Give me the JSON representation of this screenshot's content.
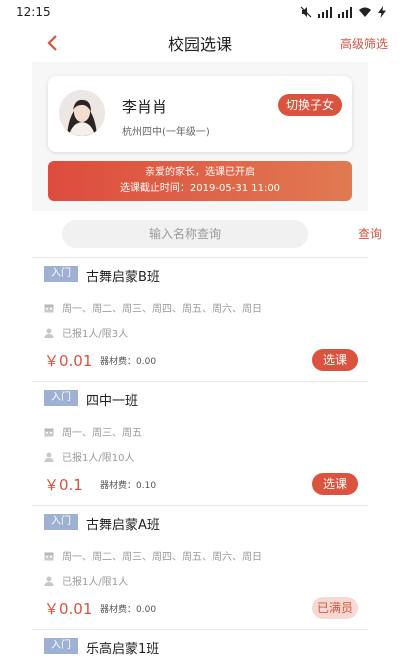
{
  "status_bar": {
    "time": "12:15"
  },
  "nav": {
    "back_icon": "chevron-left-icon",
    "title": "校园选课",
    "filter_label": "高级筛选"
  },
  "profile": {
    "name": "李肖肖",
    "school": "杭州四中(一年级一)",
    "switch_label": "切换子女"
  },
  "notice": {
    "line1": "亲爱的家长，选课已开启",
    "line2": "选课截止时间：2019-05-31 11:00"
  },
  "search": {
    "placeholder": "输入名称查询",
    "value": "",
    "button_label": "查询"
  },
  "courses": [
    {
      "badge": "入门",
      "name": "古舞启蒙B班",
      "days": "周一、周二、周三、周四、周五、周六、周日",
      "enroll": "已报1人/限3人",
      "price": "￥0.01",
      "fee": "器材费：0.00",
      "action": "选课",
      "full": false
    },
    {
      "badge": "入门",
      "name": "四中一班",
      "days": "周一、周三、周五",
      "enroll": "已报1人/限10人",
      "price": "￥0.1",
      "fee": "器材费：0.10",
      "action": "选课",
      "full": false
    },
    {
      "badge": "入门",
      "name": "古舞启蒙A班",
      "days": "周一、周二、周三、周四、周五、周六、周日",
      "enroll": "已报1人/限1人",
      "price": "￥0.01",
      "fee": "器材费：0.00",
      "action": "已满员",
      "full": true
    },
    {
      "badge": "入门",
      "name": "乐高启蒙1班"
    }
  ],
  "colors": {
    "accent": "#d9533f",
    "badge": "#9fb1d3",
    "full_bg": "#f7d9d3"
  }
}
